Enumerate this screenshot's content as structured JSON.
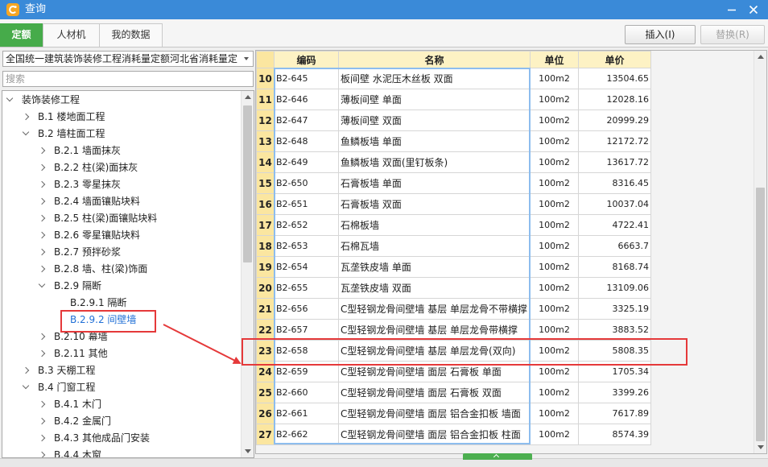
{
  "window": {
    "title": "查询",
    "icons": {
      "app": "app-icon",
      "minimize": "minimize-icon",
      "close": "close-icon"
    }
  },
  "tabs": [
    {
      "label": "定额",
      "active": true
    },
    {
      "label": "人材机",
      "active": false
    },
    {
      "label": "我的数据",
      "active": false
    }
  ],
  "toolbar": {
    "insert_label": "插入(I)",
    "replace_label": "替换(R)",
    "replace_enabled": false
  },
  "left": {
    "library": "全国统一建筑装饰装修工程消耗量定额河北省消耗量定",
    "search_placeholder": "搜索",
    "tree": [
      {
        "label": "装饰装修工程",
        "level": 0,
        "state": "expanded"
      },
      {
        "label": "B.1 楼地面工程",
        "level": 1,
        "state": "collapsed"
      },
      {
        "label": "B.2 墙柱面工程",
        "level": 1,
        "state": "expanded"
      },
      {
        "label": "B.2.1 墙面抹灰",
        "level": 2,
        "state": "collapsed"
      },
      {
        "label": "B.2.2 柱(梁)面抹灰",
        "level": 2,
        "state": "collapsed"
      },
      {
        "label": "B.2.3 零星抹灰",
        "level": 2,
        "state": "collapsed"
      },
      {
        "label": "B.2.4 墙面镶贴块料",
        "level": 2,
        "state": "collapsed"
      },
      {
        "label": "B.2.5 柱(梁)面镶贴块料",
        "level": 2,
        "state": "collapsed"
      },
      {
        "label": "B.2.6 零星镶贴块料",
        "level": 2,
        "state": "collapsed"
      },
      {
        "label": "B.2.7 预拌砂浆",
        "level": 2,
        "state": "collapsed"
      },
      {
        "label": "B.2.8 墙、柱(梁)饰面",
        "level": 2,
        "state": "collapsed"
      },
      {
        "label": "B.2.9 隔断",
        "level": 2,
        "state": "expanded"
      },
      {
        "label": "B.2.9.1 隔断",
        "level": 3,
        "state": "leaf"
      },
      {
        "label": "B.2.9.2 间壁墙",
        "level": 3,
        "state": "leaf",
        "selected": true
      },
      {
        "label": "B.2.10 幕墙",
        "level": 2,
        "state": "collapsed"
      },
      {
        "label": "B.2.11 其他",
        "level": 2,
        "state": "collapsed"
      },
      {
        "label": "B.3 天棚工程",
        "level": 1,
        "state": "collapsed"
      },
      {
        "label": "B.4 门窗工程",
        "level": 1,
        "state": "expanded"
      },
      {
        "label": "B.4.1 木门",
        "level": 2,
        "state": "collapsed"
      },
      {
        "label": "B.4.2 金属门",
        "level": 2,
        "state": "collapsed"
      },
      {
        "label": "B.4.3 其他成品门安装",
        "level": 2,
        "state": "collapsed"
      },
      {
        "label": "B.4.4 木窗",
        "level": 2,
        "state": "collapsed"
      }
    ]
  },
  "table": {
    "columns": {
      "no": "",
      "code": "编码",
      "name": "名称",
      "unit": "单位",
      "price": "单价"
    },
    "rows": [
      {
        "no": "10",
        "code": "B2-645",
        "name": "板间壁 水泥压木丝板 双面",
        "unit": "100m2",
        "price": "13504.65"
      },
      {
        "no": "11",
        "code": "B2-646",
        "name": "薄板间壁 单面",
        "unit": "100m2",
        "price": "12028.16"
      },
      {
        "no": "12",
        "code": "B2-647",
        "name": "薄板间壁 双面",
        "unit": "100m2",
        "price": "20999.29"
      },
      {
        "no": "13",
        "code": "B2-648",
        "name": "鱼鳞板墙 单面",
        "unit": "100m2",
        "price": "12172.72"
      },
      {
        "no": "14",
        "code": "B2-649",
        "name": "鱼鳞板墙 双面(里钉板条)",
        "unit": "100m2",
        "price": "13617.72"
      },
      {
        "no": "15",
        "code": "B2-650",
        "name": "石膏板墙 单面",
        "unit": "100m2",
        "price": "8316.45"
      },
      {
        "no": "16",
        "code": "B2-651",
        "name": "石膏板墙 双面",
        "unit": "100m2",
        "price": "10037.04"
      },
      {
        "no": "17",
        "code": "B2-652",
        "name": "石棉板墙",
        "unit": "100m2",
        "price": "4722.41"
      },
      {
        "no": "18",
        "code": "B2-653",
        "name": "石棉瓦墙",
        "unit": "100m2",
        "price": "6663.7"
      },
      {
        "no": "19",
        "code": "B2-654",
        "name": "瓦垄铁皮墙 单面",
        "unit": "100m2",
        "price": "8168.74"
      },
      {
        "no": "20",
        "code": "B2-655",
        "name": "瓦垄铁皮墙 双面",
        "unit": "100m2",
        "price": "13109.06"
      },
      {
        "no": "21",
        "code": "B2-656",
        "name": "C型轻钢龙骨间壁墙 基层 单层龙骨不带横撑",
        "unit": "100m2",
        "price": "3325.19"
      },
      {
        "no": "22",
        "code": "B2-657",
        "name": "C型轻钢龙骨间壁墙 基层 单层龙骨带横撑",
        "unit": "100m2",
        "price": "3883.52"
      },
      {
        "no": "23",
        "code": "B2-658",
        "name": "C型轻钢龙骨间壁墙 基层 单层龙骨(双向)",
        "unit": "100m2",
        "price": "5808.35"
      },
      {
        "no": "24",
        "code": "B2-659",
        "name": "C型轻钢龙骨间壁墙 面层 石膏板 单面",
        "unit": "100m2",
        "price": "1705.34"
      },
      {
        "no": "25",
        "code": "B2-660",
        "name": "C型轻钢龙骨间壁墙 面层 石膏板 双面",
        "unit": "100m2",
        "price": "3399.26"
      },
      {
        "no": "26",
        "code": "B2-661",
        "name": "C型轻钢龙骨间壁墙 面层 铝合金扣板 墙面",
        "unit": "100m2",
        "price": "7617.89"
      },
      {
        "no": "27",
        "code": "B2-662",
        "name": "C型轻钢龙骨间壁墙 面层 铝合金扣板 柱面",
        "unit": "100m2",
        "price": "8574.39"
      }
    ],
    "highlighted_row": "23"
  },
  "colors": {
    "titlebar": "#3a8ad8",
    "active_tab": "#46ab4a",
    "row_number": "#fbe6a0",
    "header": "#fdf2c4",
    "selected_text": "#1f6fd6",
    "annotation": "#e5393a"
  }
}
